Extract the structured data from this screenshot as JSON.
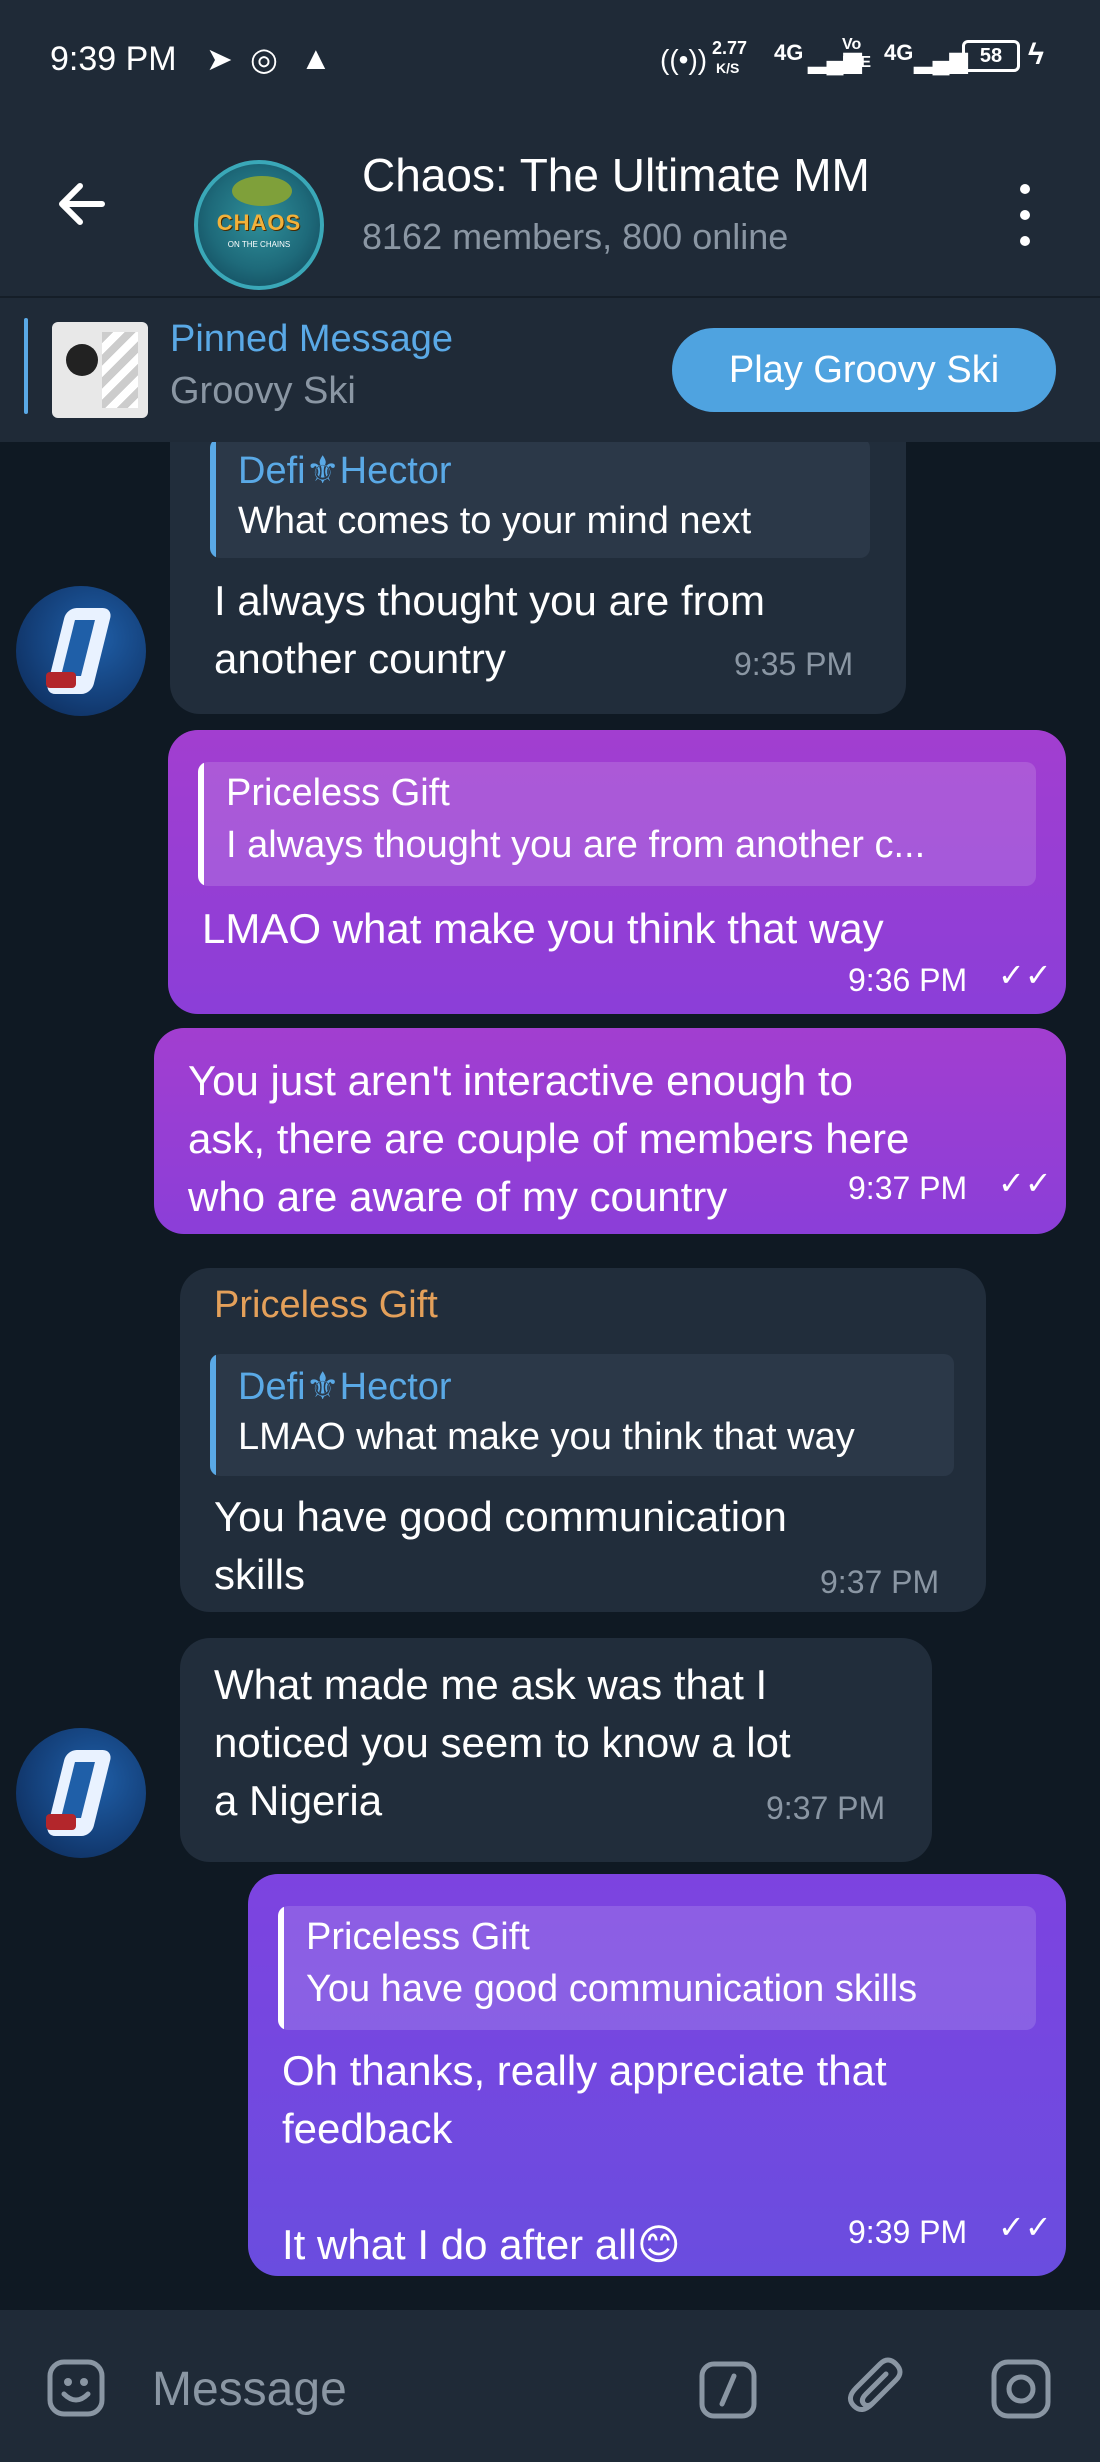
{
  "status_bar": {
    "time": "9:39 PM",
    "speed": "2.77",
    "speed_unit": "K/S",
    "network_1": "4G",
    "network_2": "Vo LTE",
    "network_3": "4G",
    "battery": "58"
  },
  "header": {
    "title": "Chaos: The Ultimate MM",
    "subtitle": "8162 members, 800 online",
    "avatar_text": "CHAOS",
    "avatar_subtext": "ON THE CHAINS"
  },
  "pinned": {
    "label": "Pinned Message",
    "text": "Groovy Ski",
    "button": "Play Groovy Ski"
  },
  "messages": [
    {
      "reply_name": "Defi⚜Hector",
      "reply_text": "What comes to your mind next",
      "text": "I always thought you are from\nanother country",
      "time": "9:35 PM"
    },
    {
      "reply_name": "Priceless Gift",
      "reply_text": "I always thought you are from another c...",
      "text": "LMAO what make you think that way",
      "time": "9:36 PM"
    },
    {
      "text": "You just aren't interactive enough to\nask, there are couple of members here\nwho are aware of my country",
      "time": "9:37 PM"
    },
    {
      "sender": "Priceless Gift",
      "reply_name": "Defi⚜Hector",
      "reply_text": "LMAO what make you think that way",
      "text": "You have good communication\nskills",
      "time": "9:37 PM"
    },
    {
      "text": "What made me ask was that I\nnoticed you seem to know a lot\na Nigeria",
      "time": "9:37 PM"
    },
    {
      "reply_name": "Priceless Gift",
      "reply_text": "You have good communication skills",
      "text": "Oh thanks, really appreciate that\nfeedback\n\nIt what I do after all😊",
      "time": "9:39 PM"
    }
  ],
  "input": {
    "placeholder": "Message"
  },
  "colors": {
    "header_bg": "#1f2a37",
    "chat_bg": "#0f1923",
    "incoming_bubble": "#212d3b",
    "accent_blue": "#5aa9e6",
    "sender_name": "#e4a05a"
  }
}
